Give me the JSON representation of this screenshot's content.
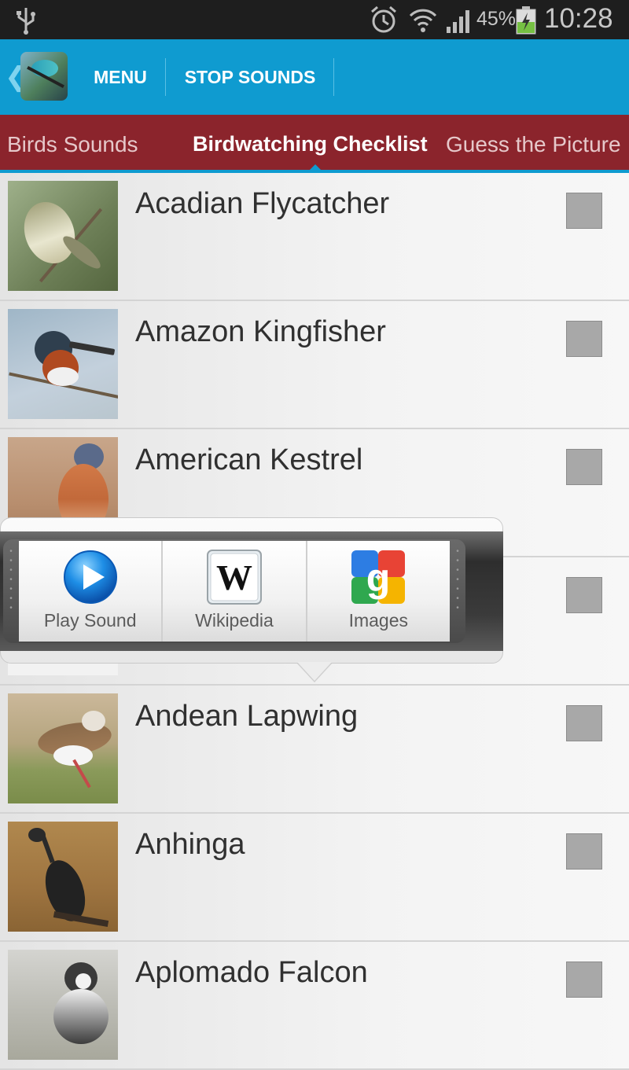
{
  "status_bar": {
    "battery_percent": "45%",
    "time": "10:28"
  },
  "action_bar": {
    "menu_label": "MENU",
    "stop_sounds_label": "STOP SOUNDS"
  },
  "tabs": [
    {
      "label": "Birds Sounds",
      "active": false
    },
    {
      "label": "Birdwatching Checklist",
      "active": true
    },
    {
      "label": "Guess the Picture",
      "active": false
    }
  ],
  "birds": [
    {
      "name": "Acadian Flycatcher",
      "checked": false
    },
    {
      "name": "Amazon Kingfisher",
      "checked": false
    },
    {
      "name": "American Kestrel",
      "checked": false
    },
    {
      "name": "",
      "checked": false
    },
    {
      "name": "Andean Lapwing",
      "checked": false
    },
    {
      "name": "Anhinga",
      "checked": false
    },
    {
      "name": "Aplomado Falcon",
      "checked": false
    }
  ],
  "popup": {
    "items": [
      {
        "label": "Play Sound",
        "icon": "play-icon"
      },
      {
        "label": "Wikipedia",
        "icon": "wikipedia-icon"
      },
      {
        "label": "Images",
        "icon": "google-images-icon"
      }
    ]
  },
  "colors": {
    "status_bar": "#1e1e1e",
    "action_bar": "#0f9bd0",
    "tab_bar": "#8b242c",
    "accent": "#0f9bd0"
  }
}
